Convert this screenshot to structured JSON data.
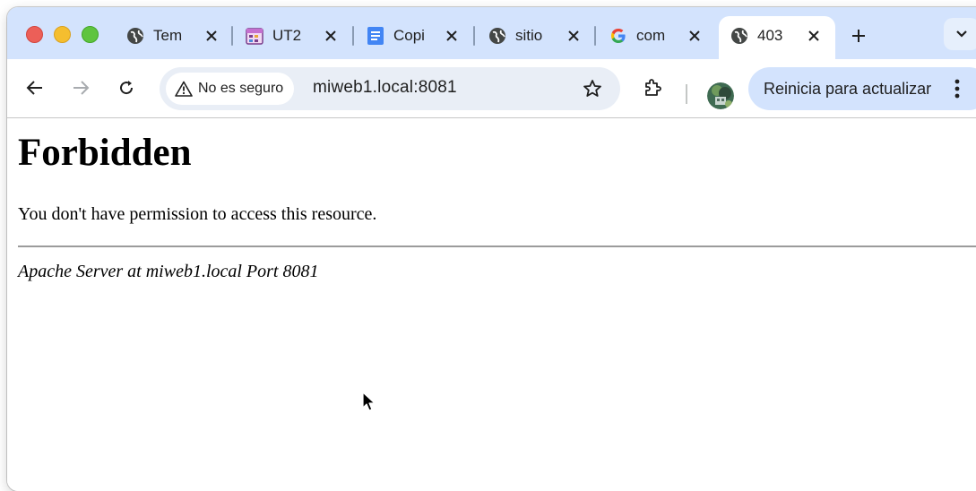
{
  "tabs": [
    {
      "title": "Tem",
      "icon": "globe-icon"
    },
    {
      "title": "UT2",
      "icon": "calendar-icon"
    },
    {
      "title": "Copi",
      "icon": "docs-icon"
    },
    {
      "title": "sitio",
      "icon": "globe-icon"
    },
    {
      "title": "com",
      "icon": "google-icon"
    },
    {
      "title": "403",
      "icon": "globe-icon",
      "active": true
    }
  ],
  "toolbar": {
    "security_label": "No es seguro",
    "url": "miweb1.local:8081",
    "update_label": "Reinicia para actualizar"
  },
  "page": {
    "heading": "Forbidden",
    "message": "You don't have permission to access this resource.",
    "address": "Apache Server at miweb1.local Port 8081"
  },
  "colors": {
    "tabstrip_bg": "#d3e3fd",
    "omnibox_bg": "#e9eef6",
    "update_pill_bg": "#d3e3fd"
  }
}
